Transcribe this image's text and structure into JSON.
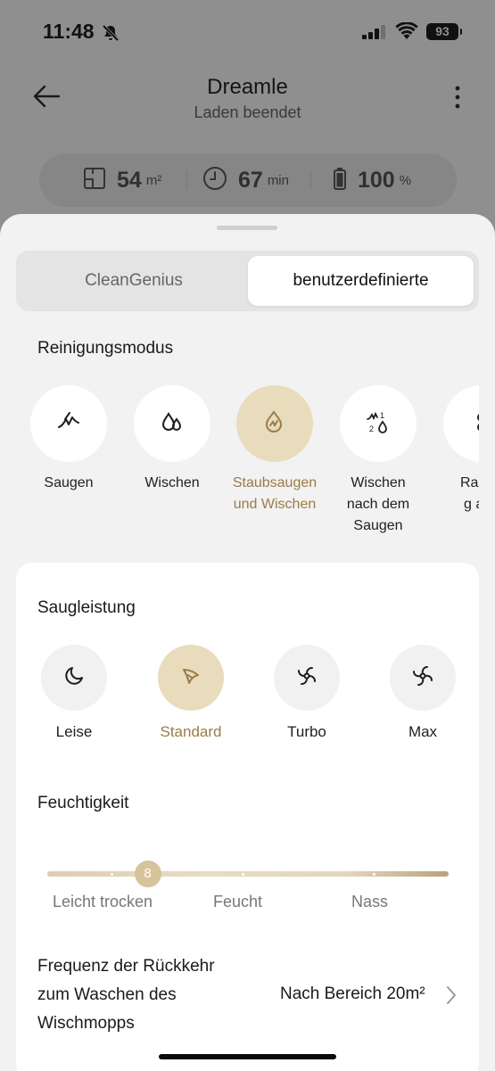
{
  "status_bar": {
    "time": "11:48",
    "battery": "93"
  },
  "header": {
    "title": "Dreamle",
    "subtitle": "Laden beendet"
  },
  "stats": {
    "area": {
      "value": "54",
      "unit": "m²"
    },
    "time": {
      "value": "67",
      "unit": "min"
    },
    "battery": {
      "value": "100",
      "unit": "%"
    }
  },
  "tabs": [
    {
      "label": "CleanGenius",
      "active": false
    },
    {
      "label": "benutzerdefinierte",
      "active": true
    }
  ],
  "cleaning_mode": {
    "heading": "Reinigungsmodus",
    "items": [
      {
        "label": "Saugen",
        "icon": "vacuum-icon"
      },
      {
        "label": "Wischen",
        "icon": "mop-drops-icon"
      },
      {
        "label": "Staubsaugen und Wischen",
        "icon": "vacuum-mop-icon",
        "selected": true
      },
      {
        "label": "Wischen nach dem Saugen",
        "icon": "vacuum-then-mop-icon"
      },
      {
        "label": "Raumr… g anp…",
        "icon": "room-custom-icon"
      }
    ],
    "item_lines": [
      [
        "Saugen"
      ],
      [
        "Wischen"
      ],
      [
        "Staubsaugen",
        "und Wischen"
      ],
      [
        "Wischen",
        "nach dem",
        "Saugen"
      ],
      [
        "Raumr",
        "g anp"
      ]
    ]
  },
  "suction": {
    "heading": "Saugleistung",
    "items": [
      {
        "label": "Leise",
        "icon": "quiet-icon"
      },
      {
        "label": "Standard",
        "icon": "standard-icon",
        "selected": true
      },
      {
        "label": "Turbo",
        "icon": "turbo-icon"
      },
      {
        "label": "Max",
        "icon": "max-icon"
      }
    ]
  },
  "humidity": {
    "heading": "Feuchtigkeit",
    "value": "8",
    "fraction": 0.25,
    "scale_labels": [
      "Leicht trocken",
      "Feucht",
      "Nass"
    ]
  },
  "return_frequency": {
    "label_lines": [
      "Frequenz der Rückkehr",
      "zum Waschen des",
      "Wischmopps"
    ],
    "value": "Nach Bereich 20m²"
  },
  "colors": {
    "accent": "#9a7b47",
    "selected_bg": "#e8dcbd",
    "sheet_bg": "#f2f2f2",
    "overlay": "#8f8f8f"
  }
}
